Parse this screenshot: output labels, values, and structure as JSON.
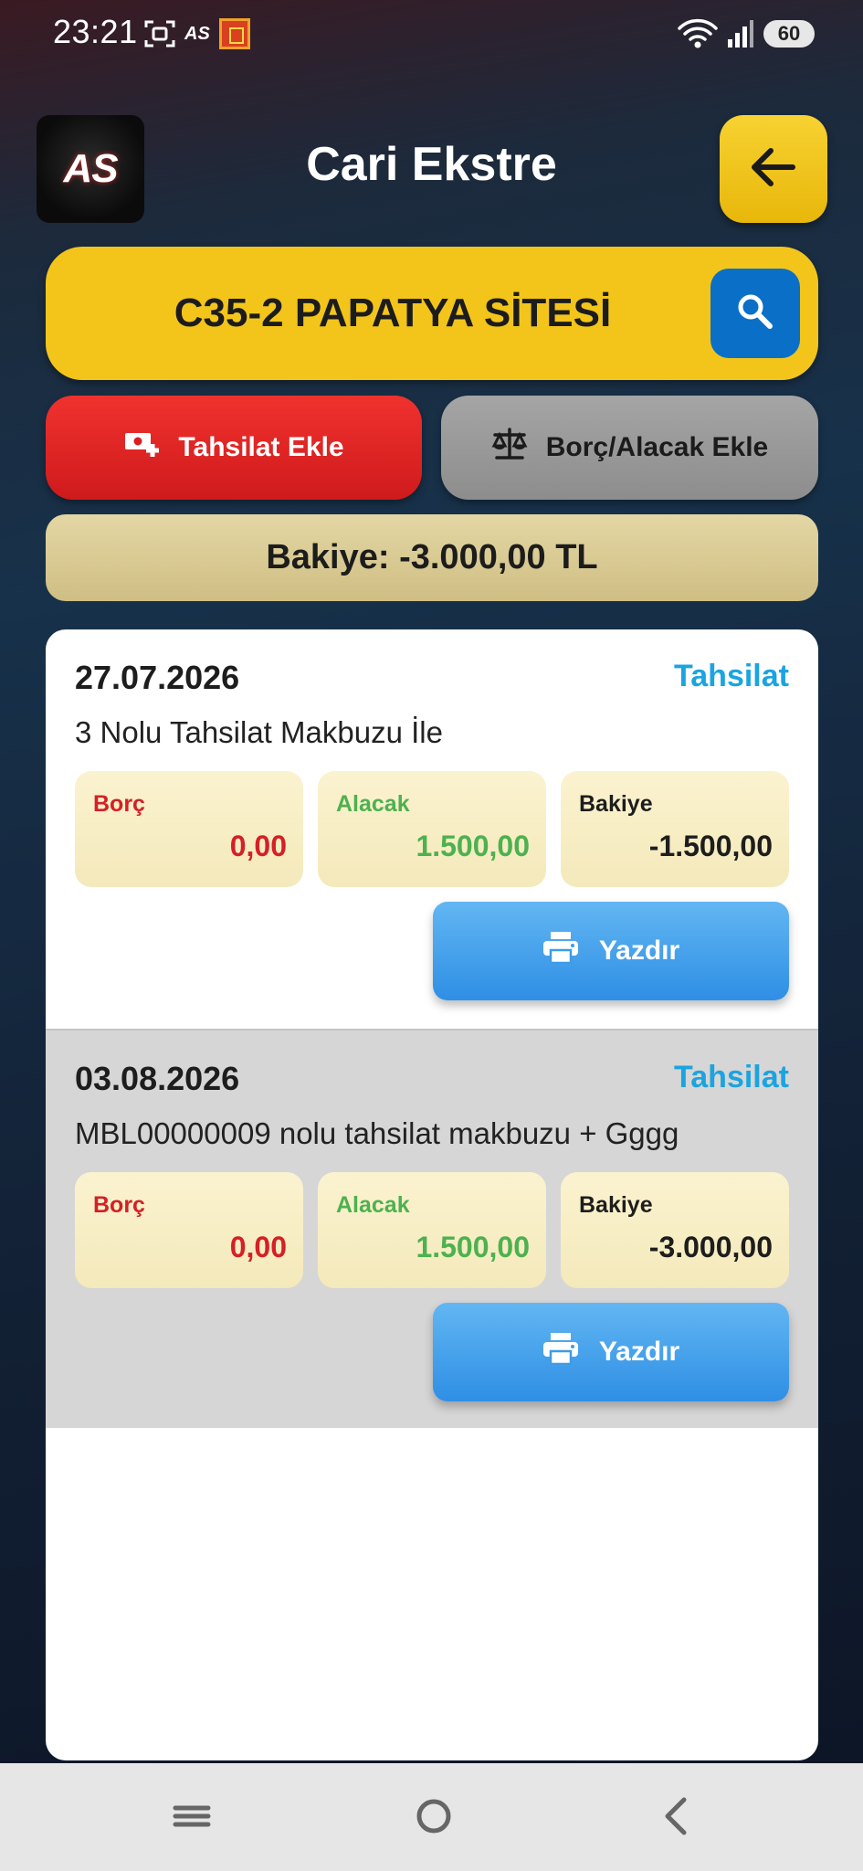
{
  "status_bar": {
    "time": "23:21",
    "app_badge": "AS",
    "battery": "60"
  },
  "header": {
    "logo_text": "AS",
    "title": "Cari Ekstre"
  },
  "customer": {
    "name": "C35-2 PAPATYA SİTESİ"
  },
  "actions": {
    "collection_label": "Tahsilat Ekle",
    "debt_label": "Borç/Alacak Ekle"
  },
  "balance": {
    "text": "Bakiye: -3.000,00 TL"
  },
  "entries": [
    {
      "date": "27.07.2026",
      "type": "Tahsilat",
      "description": "3 Nolu Tahsilat Makbuzu İle",
      "debit_label": "Borç",
      "debit": "0,00",
      "credit_label": "Alacak",
      "credit": "1.500,00",
      "balance_label": "Bakiye",
      "balance": "-1.500,00",
      "print_label": "Yazdır"
    },
    {
      "date": "03.08.2026",
      "type": "Tahsilat",
      "description": "MBL00000009 nolu tahsilat makbuzu + Gggg",
      "debit_label": "Borç",
      "debit": "0,00",
      "credit_label": "Alacak",
      "credit": "1.500,00",
      "balance_label": "Bakiye",
      "balance": "-3.000,00",
      "print_label": "Yazdır"
    }
  ],
  "colors": {
    "accent_yellow": "#f3c51b",
    "collection_red": "#e02426",
    "search_blue": "#0a6fc6",
    "type_blue": "#1ba4e0",
    "debit_red": "#d42026",
    "credit_green": "#4db14f",
    "print_blue": "#3d9be9"
  },
  "icons": {
    "back": "arrow-left-icon",
    "search": "search-icon",
    "collection": "add-payment-icon",
    "debt": "scale-icon",
    "print": "printer-icon"
  }
}
